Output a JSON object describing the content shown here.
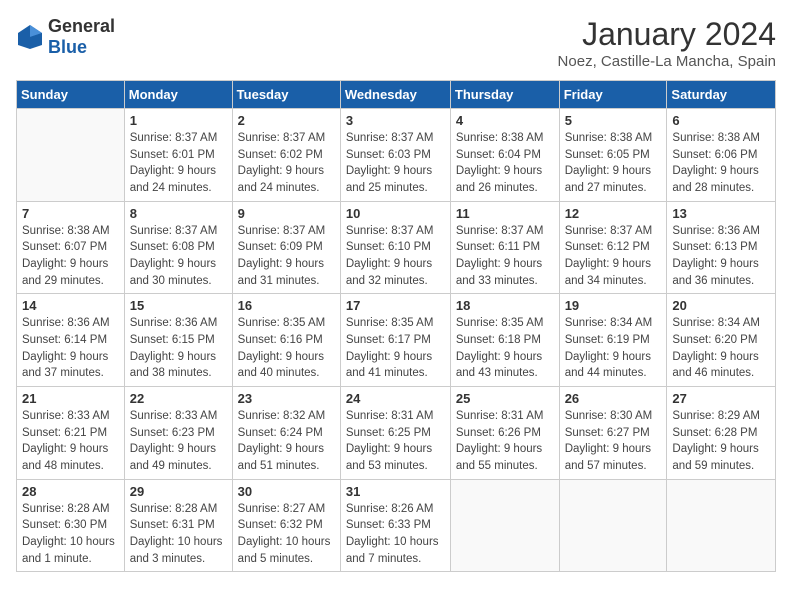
{
  "header": {
    "logo_general": "General",
    "logo_blue": "Blue",
    "month_year": "January 2024",
    "location": "Noez, Castille-La Mancha, Spain"
  },
  "days_of_week": [
    "Sunday",
    "Monday",
    "Tuesday",
    "Wednesday",
    "Thursday",
    "Friday",
    "Saturday"
  ],
  "weeks": [
    [
      {
        "day": "",
        "sunrise": "",
        "sunset": "",
        "daylight": ""
      },
      {
        "day": "1",
        "sunrise": "Sunrise: 8:37 AM",
        "sunset": "Sunset: 6:01 PM",
        "daylight": "Daylight: 9 hours and 24 minutes."
      },
      {
        "day": "2",
        "sunrise": "Sunrise: 8:37 AM",
        "sunset": "Sunset: 6:02 PM",
        "daylight": "Daylight: 9 hours and 24 minutes."
      },
      {
        "day": "3",
        "sunrise": "Sunrise: 8:37 AM",
        "sunset": "Sunset: 6:03 PM",
        "daylight": "Daylight: 9 hours and 25 minutes."
      },
      {
        "day": "4",
        "sunrise": "Sunrise: 8:38 AM",
        "sunset": "Sunset: 6:04 PM",
        "daylight": "Daylight: 9 hours and 26 minutes."
      },
      {
        "day": "5",
        "sunrise": "Sunrise: 8:38 AM",
        "sunset": "Sunset: 6:05 PM",
        "daylight": "Daylight: 9 hours and 27 minutes."
      },
      {
        "day": "6",
        "sunrise": "Sunrise: 8:38 AM",
        "sunset": "Sunset: 6:06 PM",
        "daylight": "Daylight: 9 hours and 28 minutes."
      }
    ],
    [
      {
        "day": "7",
        "sunrise": "Sunrise: 8:38 AM",
        "sunset": "Sunset: 6:07 PM",
        "daylight": "Daylight: 9 hours and 29 minutes."
      },
      {
        "day": "8",
        "sunrise": "Sunrise: 8:37 AM",
        "sunset": "Sunset: 6:08 PM",
        "daylight": "Daylight: 9 hours and 30 minutes."
      },
      {
        "day": "9",
        "sunrise": "Sunrise: 8:37 AM",
        "sunset": "Sunset: 6:09 PM",
        "daylight": "Daylight: 9 hours and 31 minutes."
      },
      {
        "day": "10",
        "sunrise": "Sunrise: 8:37 AM",
        "sunset": "Sunset: 6:10 PM",
        "daylight": "Daylight: 9 hours and 32 minutes."
      },
      {
        "day": "11",
        "sunrise": "Sunrise: 8:37 AM",
        "sunset": "Sunset: 6:11 PM",
        "daylight": "Daylight: 9 hours and 33 minutes."
      },
      {
        "day": "12",
        "sunrise": "Sunrise: 8:37 AM",
        "sunset": "Sunset: 6:12 PM",
        "daylight": "Daylight: 9 hours and 34 minutes."
      },
      {
        "day": "13",
        "sunrise": "Sunrise: 8:36 AM",
        "sunset": "Sunset: 6:13 PM",
        "daylight": "Daylight: 9 hours and 36 minutes."
      }
    ],
    [
      {
        "day": "14",
        "sunrise": "Sunrise: 8:36 AM",
        "sunset": "Sunset: 6:14 PM",
        "daylight": "Daylight: 9 hours and 37 minutes."
      },
      {
        "day": "15",
        "sunrise": "Sunrise: 8:36 AM",
        "sunset": "Sunset: 6:15 PM",
        "daylight": "Daylight: 9 hours and 38 minutes."
      },
      {
        "day": "16",
        "sunrise": "Sunrise: 8:35 AM",
        "sunset": "Sunset: 6:16 PM",
        "daylight": "Daylight: 9 hours and 40 minutes."
      },
      {
        "day": "17",
        "sunrise": "Sunrise: 8:35 AM",
        "sunset": "Sunset: 6:17 PM",
        "daylight": "Daylight: 9 hours and 41 minutes."
      },
      {
        "day": "18",
        "sunrise": "Sunrise: 8:35 AM",
        "sunset": "Sunset: 6:18 PM",
        "daylight": "Daylight: 9 hours and 43 minutes."
      },
      {
        "day": "19",
        "sunrise": "Sunrise: 8:34 AM",
        "sunset": "Sunset: 6:19 PM",
        "daylight": "Daylight: 9 hours and 44 minutes."
      },
      {
        "day": "20",
        "sunrise": "Sunrise: 8:34 AM",
        "sunset": "Sunset: 6:20 PM",
        "daylight": "Daylight: 9 hours and 46 minutes."
      }
    ],
    [
      {
        "day": "21",
        "sunrise": "Sunrise: 8:33 AM",
        "sunset": "Sunset: 6:21 PM",
        "daylight": "Daylight: 9 hours and 48 minutes."
      },
      {
        "day": "22",
        "sunrise": "Sunrise: 8:33 AM",
        "sunset": "Sunset: 6:23 PM",
        "daylight": "Daylight: 9 hours and 49 minutes."
      },
      {
        "day": "23",
        "sunrise": "Sunrise: 8:32 AM",
        "sunset": "Sunset: 6:24 PM",
        "daylight": "Daylight: 9 hours and 51 minutes."
      },
      {
        "day": "24",
        "sunrise": "Sunrise: 8:31 AM",
        "sunset": "Sunset: 6:25 PM",
        "daylight": "Daylight: 9 hours and 53 minutes."
      },
      {
        "day": "25",
        "sunrise": "Sunrise: 8:31 AM",
        "sunset": "Sunset: 6:26 PM",
        "daylight": "Daylight: 9 hours and 55 minutes."
      },
      {
        "day": "26",
        "sunrise": "Sunrise: 8:30 AM",
        "sunset": "Sunset: 6:27 PM",
        "daylight": "Daylight: 9 hours and 57 minutes."
      },
      {
        "day": "27",
        "sunrise": "Sunrise: 8:29 AM",
        "sunset": "Sunset: 6:28 PM",
        "daylight": "Daylight: 9 hours and 59 minutes."
      }
    ],
    [
      {
        "day": "28",
        "sunrise": "Sunrise: 8:28 AM",
        "sunset": "Sunset: 6:30 PM",
        "daylight": "Daylight: 10 hours and 1 minute."
      },
      {
        "day": "29",
        "sunrise": "Sunrise: 8:28 AM",
        "sunset": "Sunset: 6:31 PM",
        "daylight": "Daylight: 10 hours and 3 minutes."
      },
      {
        "day": "30",
        "sunrise": "Sunrise: 8:27 AM",
        "sunset": "Sunset: 6:32 PM",
        "daylight": "Daylight: 10 hours and 5 minutes."
      },
      {
        "day": "31",
        "sunrise": "Sunrise: 8:26 AM",
        "sunset": "Sunset: 6:33 PM",
        "daylight": "Daylight: 10 hours and 7 minutes."
      },
      {
        "day": "",
        "sunrise": "",
        "sunset": "",
        "daylight": ""
      },
      {
        "day": "",
        "sunrise": "",
        "sunset": "",
        "daylight": ""
      },
      {
        "day": "",
        "sunrise": "",
        "sunset": "",
        "daylight": ""
      }
    ]
  ]
}
